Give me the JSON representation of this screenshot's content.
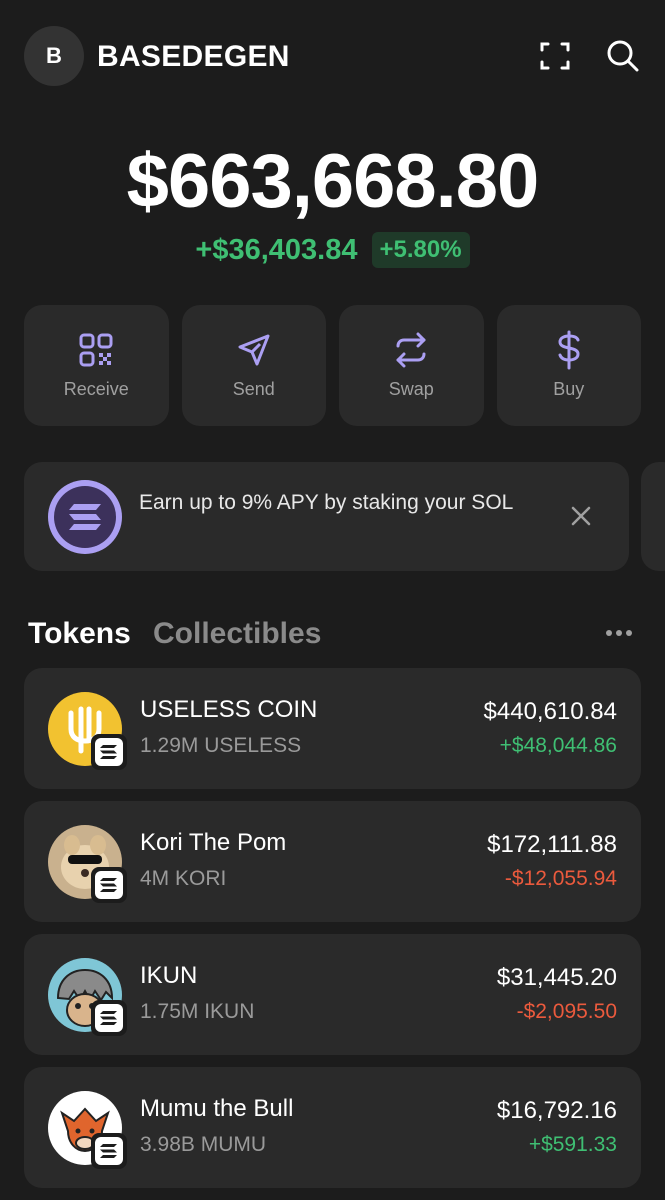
{
  "header": {
    "avatar_letter": "B",
    "account_name": "BASEDEGEN",
    "icons": [
      "scan-icon",
      "search-icon"
    ]
  },
  "balance": {
    "total": "$663,668.80",
    "change_amount": "+$36,403.84",
    "change_percent": "+5.80%"
  },
  "actions": [
    {
      "label": "Receive",
      "icon": "qr-code-icon"
    },
    {
      "label": "Send",
      "icon": "send-icon"
    },
    {
      "label": "Swap",
      "icon": "swap-icon"
    },
    {
      "label": "Buy",
      "icon": "dollar-icon"
    }
  ],
  "promo": {
    "text": "Earn up to 9% APY by staking your SOL",
    "icon": "solana-icon"
  },
  "tabs": {
    "tokens": "Tokens",
    "collectibles": "Collectibles"
  },
  "tokens": [
    {
      "name": "USELESS COIN",
      "amount": "1.29M USELESS",
      "value": "$440,610.84",
      "change": "+$48,044.86",
      "direction": "up"
    },
    {
      "name": "Kori The Pom",
      "amount": "4M KORI",
      "value": "$172,111.88",
      "change": "-$12,055.94",
      "direction": "down"
    },
    {
      "name": "IKUN",
      "amount": "1.75M IKUN",
      "value": "$31,445.20",
      "change": "-$2,095.50",
      "direction": "down"
    },
    {
      "name": "Mumu the Bull",
      "amount": "3.98B MUMU",
      "value": "$16,792.16",
      "change": "+$591.33",
      "direction": "up"
    }
  ],
  "colors": {
    "background": "#1c1c1c",
    "card": "#2a2a2a",
    "accent": "#ab9ff2",
    "positive": "#3fbf73",
    "negative": "#eb5a3d"
  }
}
